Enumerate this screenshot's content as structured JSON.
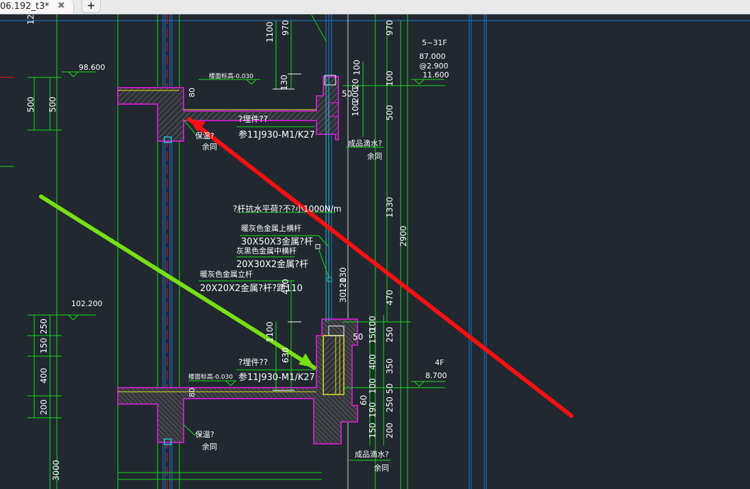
{
  "tab": {
    "title": "06.192_t3*",
    "close_symbol": "✖",
    "new_tab_symbol": "+"
  },
  "drawing": {
    "colors": {
      "background": "#212830",
      "dim": "#14e014",
      "wall": "#c020c0",
      "red": "#ff1010",
      "green_arrow": "#77e014",
      "blue": "#1a7ad0"
    },
    "levels": [
      {
        "value": "98.600"
      },
      {
        "value": "102.200"
      },
      {
        "floor": "5~31F",
        "v1": "87.000",
        "v2": "@2.900",
        "v3": "11.600"
      },
      {
        "floor": "4F",
        "v1": "8.700"
      }
    ],
    "floor_elev_upper": "楼面标高-0.030",
    "floor_elev_lower": "楼面标高-0.030",
    "embed_upper": "?埋件??",
    "ref_upper": "参11J930-M1/K27",
    "embed_lower": "?埋件??",
    "ref_lower": "参11J930-M1/K27",
    "insul_upper": "保温?",
    "same_upper": "余同",
    "insul_lower": "保温?",
    "same_lower": "余同",
    "drip_upper": "成品滴水?",
    "drip_same_upper": "余同",
    "drip_lower": "成品滴水?",
    "drip_same_lower": "余同",
    "rail_note": "?杆抗水平荷?不?小1000N/m",
    "rail_top_name": "暖灰色金属上横杆",
    "rail_top_size": "30X50X3金属?杆",
    "rail_mid_name": "灰黑色金属中横杆",
    "rail_mid_size": "20X30X2金属?杆",
    "rail_post_name": "暖灰色金属立杆",
    "rail_post_size": "20X20X2金属?杆?距110",
    "dims": {
      "d_top_12": "12",
      "d_1100_a": "1100",
      "d_970_a": "970",
      "d_970_b": "970",
      "d_500_l1": "500",
      "d_500_l2": "500",
      "d_100_a": "100",
      "d_100_b": "100",
      "d_100_c": "100",
      "d_200_a": "200",
      "d_20_a": "20",
      "d_130_a": "130",
      "d_50_a": "50",
      "d_500_r": "500",
      "d_1330": "1330",
      "d_2900": "2900",
      "d_130_b": "130",
      "d_120": "120",
      "d_30": "30",
      "d_470_a": "470",
      "d_470_b": "470",
      "d_1100_b": "1100",
      "d_630": "630",
      "d_100_d": "100",
      "d_150_a": "150",
      "d_250_a": "250",
      "d_50_b": "50",
      "d_400_a": "400",
      "d_350": "350",
      "d_100_e": "100",
      "d_50_c": "50",
      "d_60": "60",
      "d_250_b": "250",
      "d_190": "190",
      "d_150_b": "150",
      "d_200_b": "200",
      "d_250_l": "250",
      "d_150_l": "150",
      "d_400_l": "400",
      "d_200_l": "200",
      "d_3000": "3000",
      "d_80_a": "80",
      "d_80_b": "80"
    }
  }
}
